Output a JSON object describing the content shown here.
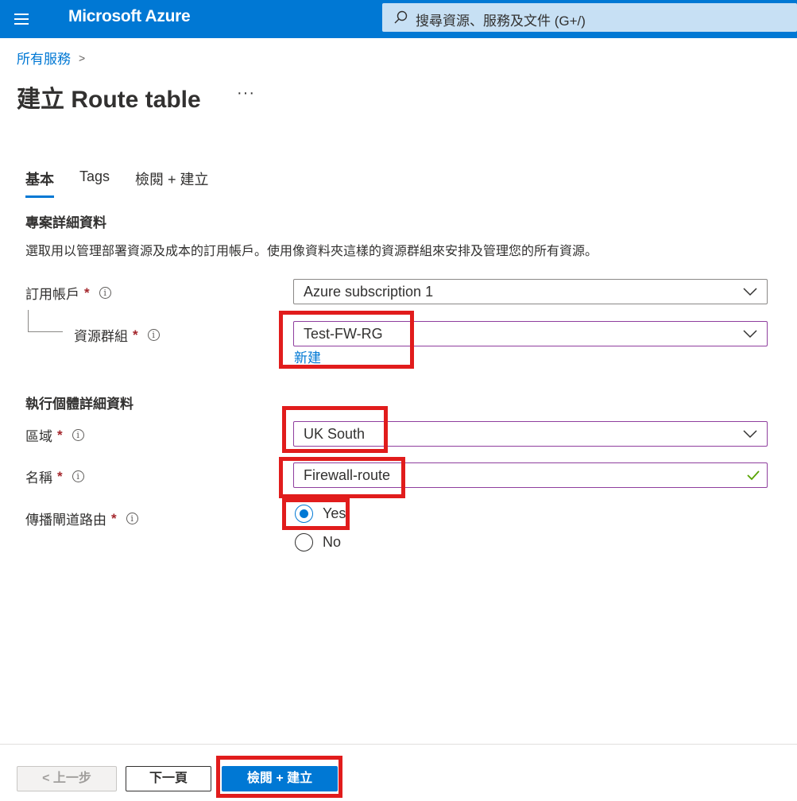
{
  "header": {
    "brand": "Microsoft Azure",
    "search_placeholder": "搜尋資源、服務及文件 (G+/)"
  },
  "breadcrumb": {
    "item": "所有服務",
    "separator": ">"
  },
  "page": {
    "title": "建立 Route table",
    "more": "···"
  },
  "tabs": [
    {
      "label": "基本",
      "active": true
    },
    {
      "label": "Tags",
      "active": false
    },
    {
      "label": "檢閱 + 建立",
      "active": false
    }
  ],
  "project_section": {
    "heading": "專案詳細資料",
    "description": "選取用以管理部署資源及成本的訂用帳戶。使用像資料夾這樣的資源群組來安排及管理您的所有資源。",
    "subscription_label": "訂用帳戶",
    "subscription_value": "Azure subscription 1",
    "resource_group_label": "資源群組",
    "resource_group_value": "Test-FW-RG",
    "create_new_link": "新建"
  },
  "instance_section": {
    "heading": "執行個體詳細資料",
    "region_label": "區域",
    "region_value": "UK South",
    "name_label": "名稱",
    "name_value": "Firewall-route",
    "propagate_label": "傳播閘道路由",
    "options": [
      {
        "label": "Yes",
        "selected": true
      },
      {
        "label": "No",
        "selected": false
      }
    ]
  },
  "required_mark": "*",
  "info_glyph": "i",
  "footer": {
    "prev_label": "< 上一步",
    "next_label": "下一頁",
    "review_label": "檢閱 + 建立"
  },
  "colors": {
    "brand_blue": "#0078d4",
    "highlight_red": "#e11c1c",
    "required_red": "#a4262c",
    "valid_green": "#57a300",
    "focused_border": "#8f3e9e"
  }
}
